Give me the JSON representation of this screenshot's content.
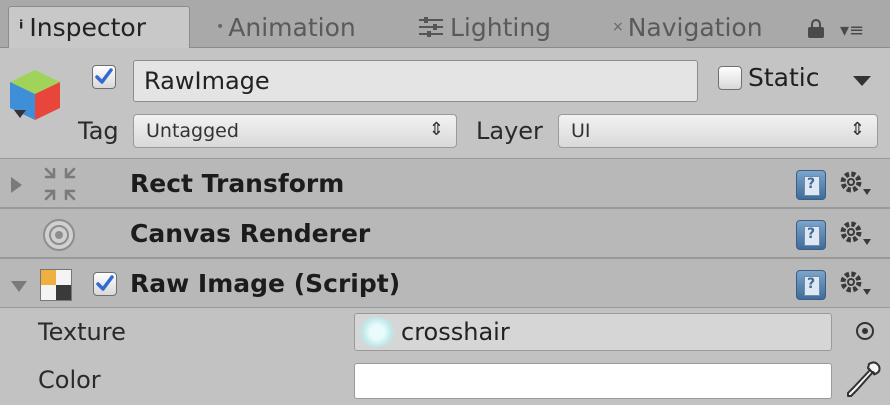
{
  "tabs": [
    {
      "label": "Inspector",
      "icon": "info-icon"
    },
    {
      "label": "Animation",
      "icon": "animation-icon"
    },
    {
      "label": "Lighting",
      "icon": "lighting-icon"
    },
    {
      "label": "Navigation",
      "icon": "navigation-icon"
    }
  ],
  "header": {
    "active": true,
    "name": "RawImage",
    "static_label": "Static",
    "static_checked": false,
    "tag_label": "Tag",
    "tag_value": "Untagged",
    "layer_label": "Layer",
    "layer_value": "UI"
  },
  "components": [
    {
      "title": "Rect Transform",
      "icon": "rect-transform-icon",
      "expanded": false
    },
    {
      "title": "Canvas Renderer",
      "icon": "canvas-renderer-icon",
      "expanded": false
    },
    {
      "title": "Raw Image (Script)",
      "icon": "raw-image-icon",
      "expanded": true,
      "enabled": true
    }
  ],
  "raw_image": {
    "texture_label": "Texture",
    "texture_value": "crosshair",
    "color_label": "Color",
    "color_value": "#ffffff"
  },
  "colors": {
    "tab_bar": "#a9a9a9",
    "panel": "#c2c2c2",
    "component_header": "#b8b8b8",
    "checkbox_check": "#2f6bd0"
  }
}
